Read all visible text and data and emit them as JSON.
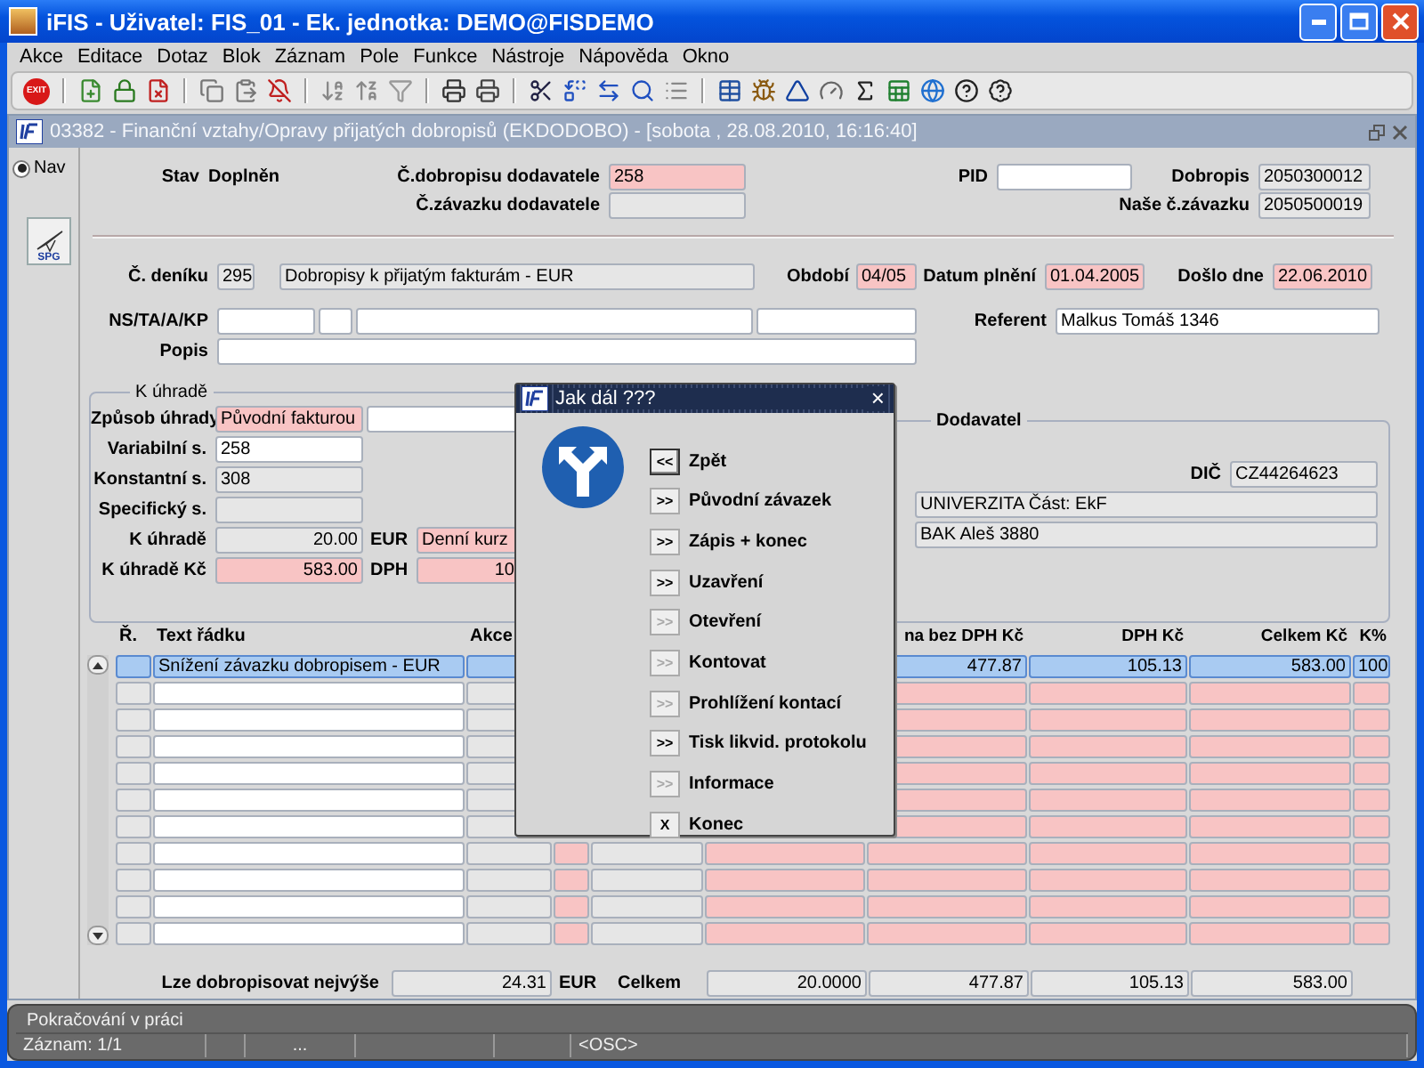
{
  "window": {
    "title": "iFIS - Uživatel: FIS_01 - Ek. jednotka: DEMO@FISDEMO"
  },
  "menu": [
    "Akce",
    "Editace",
    "Dotaz",
    "Blok",
    "Záznam",
    "Pole",
    "Funkce",
    "Nástroje",
    "Nápověda",
    "Okno"
  ],
  "toolbar": {
    "exit_label": "EXIT"
  },
  "form_window": {
    "title": "03382 - Finanční vztahy/Opravy přijatých dobropisů (EKDODOBO) - [sobota , 28.08.2010, 16:16:40]"
  },
  "nav": {
    "radio": {
      "label": "Nav",
      "selected": true
    },
    "button_label": "SPG"
  },
  "header": {
    "stav_label": "Stav",
    "stav": "Doplněn",
    "dobropis_dodavatele": {
      "label": "Č.dobropisu dodavatele",
      "value": "258",
      "kind": "required"
    },
    "zavazek_dodavatele": {
      "label": "Č.závazku dodavatele",
      "kind": "readonly"
    },
    "pid": {
      "label": "PID",
      "kind": "editable"
    },
    "dobropis": {
      "label": "Dobropis",
      "value": "2050300012",
      "kind": "readonly"
    },
    "nase_zavazek": {
      "label": "Naše č.závazku",
      "value": "2050500019",
      "kind": "readonly"
    },
    "denik": {
      "label": "Č. deníku",
      "value": "295",
      "kind": "readonly"
    },
    "denik_nazev": {
      "value": "Dobropisy k přijatým fakturám - EUR",
      "kind": "readonly"
    },
    "obdobi": {
      "label": "Období",
      "value": "04/05",
      "kind": "required"
    },
    "datum_plneni": {
      "label": "Datum plnění",
      "value": "01.04.2005",
      "kind": "required"
    },
    "doslo_dne": {
      "label": "Došlo dne",
      "value": "22.06.2010",
      "kind": "required"
    },
    "ns_label": "NS/TA/A/KP",
    "ns_fields": [
      {
        "kind": "editable"
      },
      {
        "kind": "editable"
      },
      {
        "kind": "editable"
      },
      {
        "kind": "editable"
      }
    ],
    "referent": {
      "label": "Referent",
      "value": "Malkus Tomáš 1346",
      "kind": "editable"
    },
    "popis": {
      "label": "Popis",
      "kind": "editable"
    }
  },
  "k_uhrade": {
    "title": "K úhradě",
    "rows": [
      {
        "label": "Způsob úhrady",
        "value": "Původní fakturou",
        "kind": "required",
        "extra": {
          "kind": "editable"
        }
      },
      {
        "label": "Variabilní s.",
        "value": "258",
        "kind": "editable"
      },
      {
        "label": "Konstantní s.",
        "value": "308",
        "kind": "readonly"
      },
      {
        "label": "Specifický s.",
        "kind": "readonly"
      },
      {
        "label": "K úhradě",
        "value": "20.00",
        "kind": "readonly",
        "unit": "EUR",
        "extra": {
          "value": "Denní kurz",
          "kind": "required"
        }
      },
      {
        "label": "K úhradě Kč",
        "value": "583.00",
        "kind": "required",
        "unit": "DPH",
        "extra": {
          "value": "10",
          "kind": "required",
          "numeric": true
        }
      }
    ]
  },
  "dodavatel": {
    "title": "Dodavatel",
    "dic": {
      "label": "DIČ",
      "value": "CZ44264623"
    },
    "nazev": "UNIVERZITA Část: EkF",
    "adresa": "BAK Aleš 3880"
  },
  "table": {
    "columns": [
      {
        "label": "Ř.",
        "kind": "readonly"
      },
      {
        "label": "Text řádku",
        "kind": "editable"
      },
      {
        "label": "Akce",
        "kind": "readonly"
      },
      {
        "kind": "required"
      },
      {
        "kind": "readonly"
      },
      {
        "kind": "required"
      },
      {
        "label": "na bez DPH Kč",
        "kind": "required"
      },
      {
        "label": "DPH Kč",
        "kind": "required"
      },
      {
        "label": "Celkem Kč",
        "kind": "required"
      },
      {
        "label": "K%",
        "kind": "required"
      }
    ],
    "rows": [
      {
        "selected": true,
        "text": "Snížení závazku dobropisem - EUR",
        "bez_dph": "477.87",
        "dph": "105.13",
        "celkem": "583.00",
        "k_pct": "100"
      },
      {
        "selected": false
      },
      {
        "selected": false
      },
      {
        "selected": false
      },
      {
        "selected": false
      },
      {
        "selected": false
      },
      {
        "selected": false
      },
      {
        "selected": false
      },
      {
        "selected": false
      },
      {
        "selected": false
      },
      {
        "selected": false
      }
    ]
  },
  "footer": {
    "limit_label": "Lze dobropisovat nejvýše",
    "limit": "24.31",
    "limit_unit": "EUR",
    "celkem_label": "Celkem",
    "totals": [
      "20.0000",
      "477.87",
      "105.13",
      "583.00"
    ]
  },
  "dialog": {
    "title": "Jak dál ???",
    "close": "×",
    "buttons": [
      {
        "glyph": "<<",
        "label": "Zpět",
        "disabled": false,
        "focused": true
      },
      {
        "glyph": ">>",
        "label": "Původní závazek",
        "disabled": false,
        "focused": false
      },
      {
        "glyph": ">>",
        "label": "Zápis + konec",
        "disabled": false,
        "focused": false
      },
      {
        "glyph": ">>",
        "label": "Uzavření",
        "disabled": false,
        "focused": false
      },
      {
        "glyph": ">>",
        "label": "Otevření",
        "disabled": true,
        "focused": false
      },
      {
        "glyph": ">>",
        "label": "Kontovat",
        "disabled": true,
        "focused": false
      },
      {
        "glyph": ">>",
        "label": "Prohlížení kontací",
        "disabled": true,
        "focused": false
      },
      {
        "glyph": ">>",
        "label": "Tisk likvid. protokolu",
        "disabled": false,
        "focused": false
      },
      {
        "glyph": ">>",
        "label": "Informace",
        "disabled": true,
        "focused": false
      },
      {
        "glyph": "X",
        "label": "Konec",
        "disabled": false,
        "focused": false
      }
    ]
  },
  "status_bar": {
    "message": "Pokračování v práci",
    "record": "Záznam: 1/1",
    "segment_4": "...",
    "osc": "<OSC>"
  }
}
